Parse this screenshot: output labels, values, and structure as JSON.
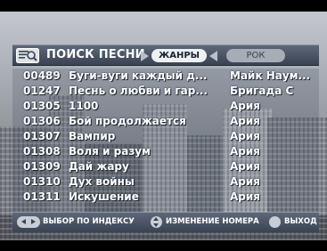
{
  "header": {
    "icon": "search-list-icon",
    "title": "ПОИСК ПЕСНИ",
    "category_active": "ЖАНРЫ",
    "category_value": "РОК"
  },
  "songs": [
    {
      "number": "00489",
      "title": "Буги-вуги каждый д...",
      "artist": "Майк Наум..."
    },
    {
      "number": "01247",
      "title": "Песнь о любви и гар...",
      "artist": "Бригада С"
    },
    {
      "number": "01305",
      "title": "1100",
      "artist": "Ария"
    },
    {
      "number": "01306",
      "title": "Бой продолжается",
      "artist": "Ария"
    },
    {
      "number": "01307",
      "title": "Вампир",
      "artist": "Ария"
    },
    {
      "number": "01308",
      "title": "Воля и разум",
      "artist": "Ария"
    },
    {
      "number": "01309",
      "title": "Дай жару",
      "artist": "Ария"
    },
    {
      "number": "01310",
      "title": "Дух войны",
      "artist": "Ария"
    },
    {
      "number": "01311",
      "title": "Искушение",
      "artist": "Ария"
    }
  ],
  "footer": {
    "index_label": "ВЫБОР ПО ИНДЕКСУ",
    "change_label": "ИЗМЕНЕНИЕ НОМЕРА",
    "exit_label": "ВЫХОД"
  },
  "colors": {
    "panel": "#3a4352",
    "text": "#ffffff",
    "pill_active": "#eef0f3",
    "pill_inactive": "#a7adb7"
  }
}
